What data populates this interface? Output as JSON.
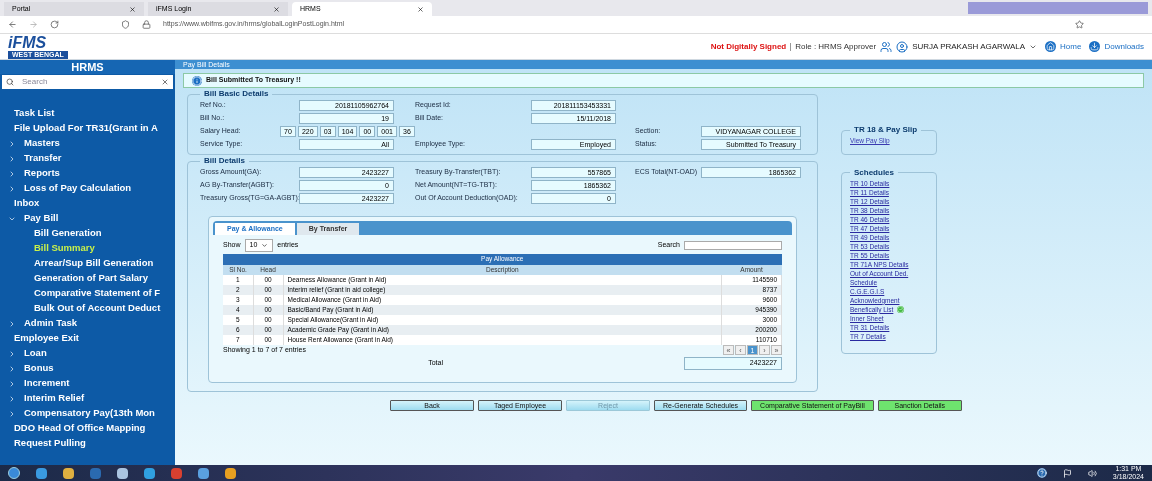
{
  "browser": {
    "tabs": [
      {
        "label": "Portal",
        "selected": false
      },
      {
        "label": "iFMS Login",
        "selected": false
      },
      {
        "label": "HRMS",
        "selected": true
      }
    ],
    "url": "https://www.wbifms.gov.in/hrms/globalLoginPostLogin.html"
  },
  "header": {
    "logo": "iFMS",
    "logo_sub": "WEST BENGAL",
    "sign_status": "Not Digitally Signed",
    "role": "Role : HRMS Approver",
    "user": "SURJA PRAKASH AGARWALA",
    "links": [
      "Home",
      "Downloads"
    ]
  },
  "sidebar": {
    "title": "HRMS",
    "search_placeholder": "Search",
    "items": [
      {
        "label": "Task List",
        "kind": "link",
        "selected": false
      },
      {
        "label": "File Upload For TR31(Grant in A",
        "kind": "link",
        "selected": false
      },
      {
        "label": "Masters",
        "kind": "group",
        "expanded": false,
        "selected": false
      },
      {
        "label": "Transfer",
        "kind": "group",
        "expanded": false,
        "selected": false
      },
      {
        "label": "Reports",
        "kind": "group",
        "expanded": false,
        "selected": false
      },
      {
        "label": "Loss of Pay Calculation",
        "kind": "group",
        "expanded": false,
        "selected": false
      },
      {
        "label": "Inbox",
        "kind": "link",
        "selected": false
      },
      {
        "label": "Pay Bill",
        "kind": "group",
        "expanded": true,
        "selected": false,
        "children": [
          {
            "label": "Bill Generation",
            "selected": false
          },
          {
            "label": "Bill Summary",
            "selected": true
          },
          {
            "label": "Arrear/Sup Bill Generation",
            "selected": false
          },
          {
            "label": "Generation of Part Salary",
            "selected": false
          },
          {
            "label": "Comparative Statement of F",
            "selected": false
          },
          {
            "label": "Bulk Out of Account Deduct",
            "selected": false
          }
        ]
      },
      {
        "label": "Admin Task",
        "kind": "group",
        "expanded": false,
        "selected": false
      },
      {
        "label": "Employee Exit",
        "kind": "link",
        "selected": false
      },
      {
        "label": "Loan",
        "kind": "group",
        "expanded": false,
        "selected": false
      },
      {
        "label": "Bonus",
        "kind": "group",
        "expanded": false,
        "selected": false
      },
      {
        "label": "Increment",
        "kind": "group",
        "expanded": false,
        "selected": false
      },
      {
        "label": "Interim Relief",
        "kind": "group",
        "expanded": false,
        "selected": false
      },
      {
        "label": "Compensatory Pay(13th Mon",
        "kind": "group",
        "expanded": false,
        "selected": false
      },
      {
        "label": "DDO Head Of Office Mapping",
        "kind": "link",
        "selected": false
      },
      {
        "label": "Request Pulling",
        "kind": "link",
        "selected": false
      }
    ]
  },
  "page": {
    "title": "Pay Bill Details",
    "alert": "Bill Submitted To Treasury !!",
    "basic": {
      "legend": "Bill Basic Details",
      "rows": [
        {
          "left": {
            "label": "Ref No.:",
            "value": "20181105962764"
          },
          "middle": {
            "label": "Request Id:",
            "value": "201811153453331"
          }
        },
        {
          "left": {
            "label": "Bill No.:",
            "value": "19"
          },
          "middle": {
            "label": "Bill Date:",
            "value": "15/11/2018"
          }
        },
        {
          "left": {
            "label": "Salary Head:",
            "segments": [
              "70",
              "220",
              "03",
              "104",
              "00",
              "001",
              "36"
            ]
          },
          "right": {
            "label": "Section:",
            "value": "VIDYANAGAR COLLEGE"
          }
        },
        {
          "left": {
            "label": "Service Type:",
            "value": "All"
          },
          "middle": {
            "label": "Employee Type:",
            "value": "Employed"
          },
          "right": {
            "label": "Status:",
            "value": "Submitted To Treasury"
          }
        }
      ]
    },
    "details": {
      "legend": "Bill Details",
      "rows": [
        {
          "left": {
            "label": "Gross Amount(GA):",
            "value": "2423227"
          },
          "middle": {
            "label": "Treasury By-Transfer(TBT):",
            "value": "557865"
          },
          "right": {
            "label": "ECS Total(NT-OAD)",
            "value": "1865362"
          }
        },
        {
          "left": {
            "label": "AG By-Transfer(AGBT):",
            "value": "0"
          },
          "middle": {
            "label": "Net Amount(NT=TG-TBT):",
            "value": "1865362"
          }
        },
        {
          "left": {
            "label": "Treasury Gross(TG=GA-AGBT):",
            "value": "2423227"
          },
          "middle": {
            "label": "Out Of Account Deduction(OAD):",
            "value": "0"
          }
        }
      ]
    },
    "tabs": [
      {
        "label": "Pay & Allowance",
        "selected": true
      },
      {
        "label": "By Transfer",
        "selected": false
      }
    ],
    "table": {
      "show_label": "Show",
      "page_size": "10",
      "entries_label": "entries",
      "search_label": "Search",
      "caption": "Pay Allowance",
      "columns": [
        "Sl No.",
        "Head",
        "Description",
        "Amount"
      ],
      "rows": [
        [
          "1",
          "00",
          "Dearness Allowance (Grant in Aid)",
          "1145590"
        ],
        [
          "2",
          "00",
          "Interim relief (Grant in aid college)",
          "8737"
        ],
        [
          "3",
          "00",
          "Medical Allowance (Grant in Aid)",
          "9600"
        ],
        [
          "4",
          "00",
          "Basic/Band Pay (Grant in Aid)",
          "945390"
        ],
        [
          "5",
          "00",
          "Special Allowance(Grant in Aid)",
          "3000"
        ],
        [
          "6",
          "00",
          "Academic Grade Pay (Grant in Aid)",
          "200200"
        ],
        [
          "7",
          "00",
          "House Rent Allowance (Grant in Aid)",
          "110710"
        ]
      ],
      "info": "Showing 1 to 7 of 7 entries",
      "pages": [
        {
          "label": "«",
          "selected": false
        },
        {
          "label": "‹",
          "selected": false
        },
        {
          "label": "1",
          "selected": true
        },
        {
          "label": "›",
          "selected": false
        },
        {
          "label": "»",
          "selected": false
        }
      ],
      "total_label": "Total",
      "total": "2423227"
    },
    "buttons": [
      {
        "label": "Back",
        "kind": "plain",
        "disabled": false
      },
      {
        "label": "Taged Employee",
        "kind": "plain",
        "disabled": false
      },
      {
        "label": "Reject",
        "kind": "plain",
        "disabled": true
      },
      {
        "label": "Re-Generate Schedules",
        "kind": "plain",
        "disabled": false
      },
      {
        "label": "Comparative Statement of PayBill",
        "kind": "highlight",
        "disabled": false
      },
      {
        "label": "Sanction Details",
        "kind": "highlight",
        "disabled": false
      }
    ],
    "pay_slip": {
      "legend": "TR 18 & Pay Slip",
      "links": [
        "View Pay Slip"
      ]
    },
    "schedules": {
      "legend": "Schedules",
      "links": [
        {
          "label": "TR 10 Details",
          "verified": false
        },
        {
          "label": "TR 11 Details",
          "verified": false
        },
        {
          "label": "TR 12 Details",
          "verified": false
        },
        {
          "label": "TR 38 Details",
          "verified": false
        },
        {
          "label": "TR 46 Details",
          "verified": false
        },
        {
          "label": "TR 47 Details",
          "verified": false
        },
        {
          "label": "TR 49 Details",
          "verified": false
        },
        {
          "label": "TR 53 Details",
          "verified": false
        },
        {
          "label": "TR 55 Details",
          "verified": false
        },
        {
          "label": "TR 71A NPS Details",
          "verified": false
        },
        {
          "label": "Out of Account Ded. Schedule",
          "verified": false
        },
        {
          "label": "C.G.E.G.I.S",
          "verified": false
        },
        {
          "label": "Acknowledgment",
          "verified": false
        },
        {
          "label": "Benefically List",
          "verified": true
        },
        {
          "label": "Inner Sheet",
          "verified": false
        },
        {
          "label": "TR  31 Details",
          "verified": false
        },
        {
          "label": "TR  7 Details",
          "verified": false
        }
      ]
    }
  },
  "taskbar": {
    "time": "1:31 PM",
    "date": "3/18/2024"
  }
}
